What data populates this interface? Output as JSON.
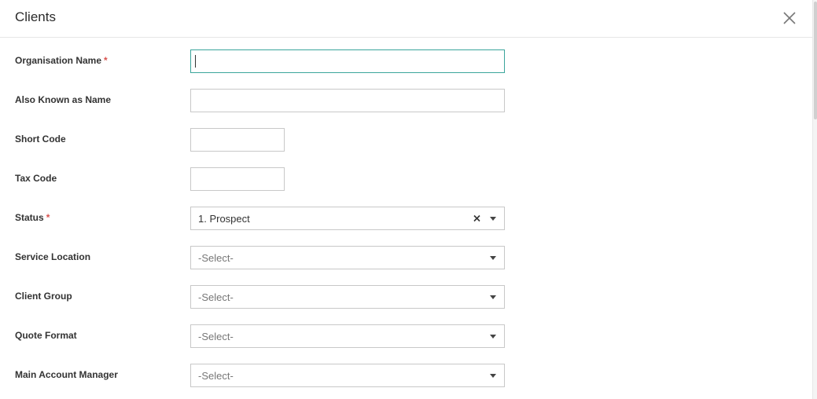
{
  "dialog": {
    "title": "Clients",
    "close_icon": "close-icon"
  },
  "form": {
    "required_marker": "*",
    "organisation_name": {
      "label": "Organisation Name",
      "required": true,
      "value": ""
    },
    "also_known_as": {
      "label": "Also Known as Name",
      "value": ""
    },
    "short_code": {
      "label": "Short Code",
      "value": ""
    },
    "tax_code": {
      "label": "Tax Code",
      "value": ""
    },
    "status": {
      "label": "Status",
      "required": true,
      "value": "1. Prospect",
      "clear_icon": "clear-icon"
    },
    "service_location": {
      "label": "Service Location",
      "value": "-Select-"
    },
    "client_group": {
      "label": "Client Group",
      "value": "-Select-"
    },
    "quote_format": {
      "label": "Quote Format",
      "value": "-Select-"
    },
    "main_account_manager": {
      "label": "Main Account Manager",
      "value": "-Select-"
    }
  },
  "colors": {
    "focus_border": "#3aa59b",
    "required": "#d9534f"
  }
}
